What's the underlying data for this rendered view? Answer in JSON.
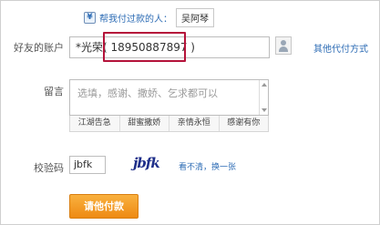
{
  "recent_payer": {
    "icon": "payer-badge-icon",
    "label": "帮我付过款的人：",
    "name": "吴阿琴"
  },
  "account": {
    "label": "好友的账户",
    "value": "*光荣( 18950887897 )",
    "other_method_link": "其他代付方式 "
  },
  "message": {
    "label": "留言",
    "placeholder": "选填，感谢、撒娇、乞求都可以",
    "quick_phrases": [
      "江湖告急",
      "甜蜜撒娇",
      "亲情永恒",
      "感谢有你"
    ]
  },
  "captcha": {
    "label": "校验码",
    "value": "jbfk",
    "image_text": "jbfk",
    "refresh_link": "看不清，换一张"
  },
  "pay_button": {
    "label": "请他付款"
  },
  "colors": {
    "link": "#2d6cb5",
    "highlight_border": "#b5133a",
    "button_orange": "#f39a22"
  }
}
